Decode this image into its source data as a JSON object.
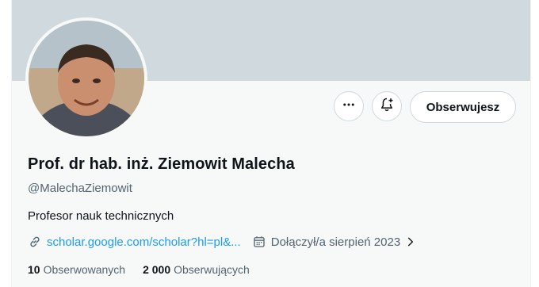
{
  "profile": {
    "name": "Prof. dr hab. inż. Ziemowit Malecha",
    "handle": "@MalechaZiemowit",
    "bio": "Profesor nauk technicznych",
    "website": "scholar.google.com/scholar?hl=pl&...",
    "joined": "Dołączył/a sierpień 2023",
    "following_count": "10",
    "following_label": "Obserwowanych",
    "followers_count": "2 000",
    "followers_label": "Obserwujących"
  },
  "actions": {
    "follow_label": "Obserwujesz",
    "more_icon": "more-icon",
    "notify_icon": "notification-bell-plus-icon"
  },
  "colors": {
    "banner": "#cfd9de",
    "accent": "#1d9bf0",
    "secondary_text": "#536471",
    "primary_text": "#0f1419"
  }
}
